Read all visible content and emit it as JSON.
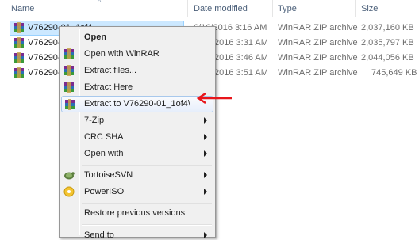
{
  "columns": {
    "name": "Name",
    "date": "Date modified",
    "type": "Type",
    "size": "Size"
  },
  "files": [
    {
      "name": "V76290-01_1of4",
      "date": "6/16/2016 3:16 AM",
      "type": "WinRAR ZIP archive",
      "size": "2,037,160 KB",
      "selected": true
    },
    {
      "name": "V76290-0",
      "date": "2016 3:31 AM",
      "type": "WinRAR ZIP archive",
      "size": "2,035,797 KB"
    },
    {
      "name": "V76290-0",
      "date": "2016 3:46 AM",
      "type": "WinRAR ZIP archive",
      "size": "2,044,056 KB"
    },
    {
      "name": "V76290-0",
      "date": "2016 3:51 AM",
      "type": "WinRAR ZIP archive",
      "size": "745,649 KB"
    }
  ],
  "menu": {
    "open": "Open",
    "open_winrar": "Open with WinRAR",
    "extract_files": "Extract files...",
    "extract_here": "Extract Here",
    "extract_to": "Extract to V76290-01_1of4\\",
    "seven_zip": "7-Zip",
    "crc_sha": "CRC SHA",
    "open_with": "Open with",
    "tortoise": "TortoiseSVN",
    "poweriso": "PowerISO",
    "restore": "Restore previous versions",
    "send_to": "Send to"
  },
  "colors": {
    "selection": "#cce8ff",
    "menu_bg": "#f0f0f0",
    "arrow": "#e8161b"
  },
  "icons": {
    "file": "winrar-archive-icon",
    "tortoise": "tortoisesvn-icon",
    "poweriso": "poweriso-icon",
    "annotation": "red-arrow-icon"
  }
}
